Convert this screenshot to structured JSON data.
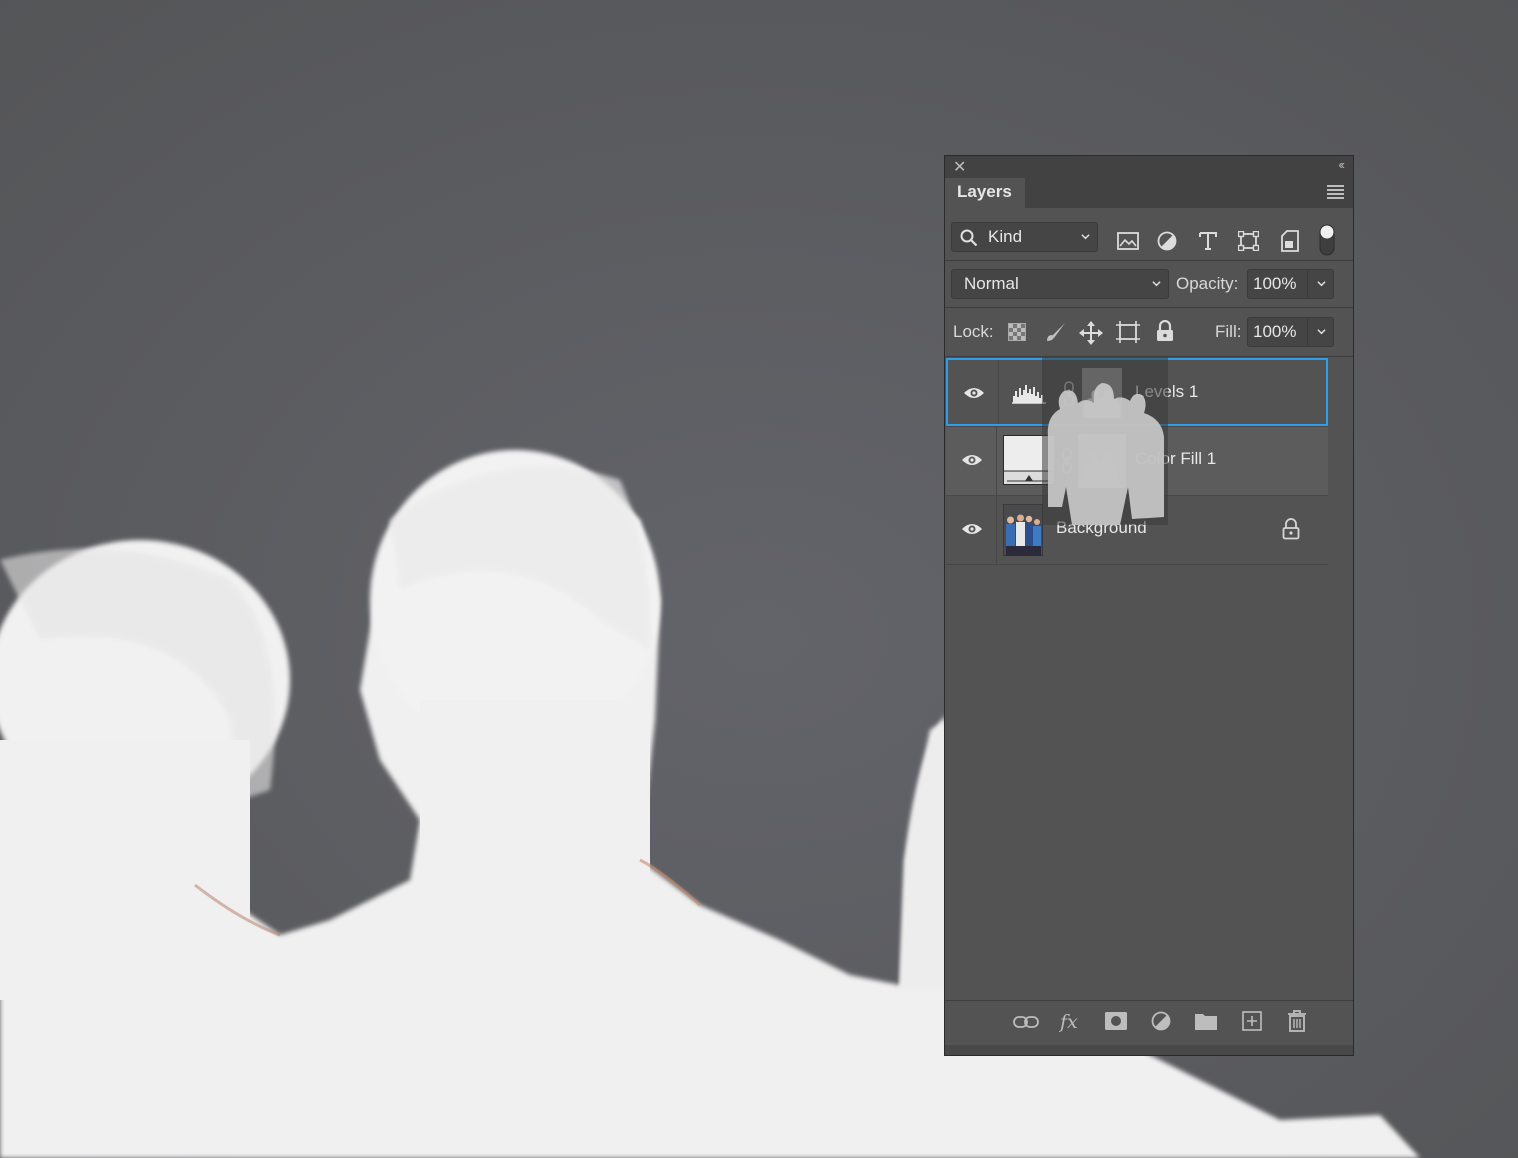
{
  "panel": {
    "tab_title": "Layers",
    "filter_kind": "Kind",
    "blend_mode": "Normal",
    "opacity_label": "Opacity:",
    "opacity_value": "100%",
    "lock_label": "Lock:",
    "fill_label": "Fill:",
    "fill_value": "100%"
  },
  "layers": [
    {
      "name": "Levels 1",
      "visible": true,
      "selected": true,
      "type": "adjustment-levels"
    },
    {
      "name": "Color Fill 1",
      "visible": true,
      "selected": false,
      "type": "color-fill"
    },
    {
      "name": "Background",
      "visible": true,
      "selected": false,
      "locked": true,
      "type": "image"
    }
  ],
  "colors": {
    "panel_bg": "#535353",
    "selection_outline": "#2e9ee6",
    "canvas_bg": "#595a5c",
    "silhouette": "#f1f0f0"
  },
  "icons": {
    "filter": [
      "image-filter-icon",
      "adjustment-filter-icon",
      "type-filter-icon",
      "shape-filter-icon",
      "smart-object-filter-icon",
      "filter-toggle-icon"
    ],
    "lock": [
      "lock-transparent-pixels-icon",
      "lock-image-pixels-icon",
      "lock-position-icon",
      "lock-artboard-icon",
      "lock-all-icon"
    ],
    "bottom": [
      "link-layers-icon",
      "fx-icon",
      "add-mask-icon",
      "new-adjustment-icon",
      "new-group-icon",
      "new-layer-icon",
      "delete-layer-icon"
    ]
  }
}
